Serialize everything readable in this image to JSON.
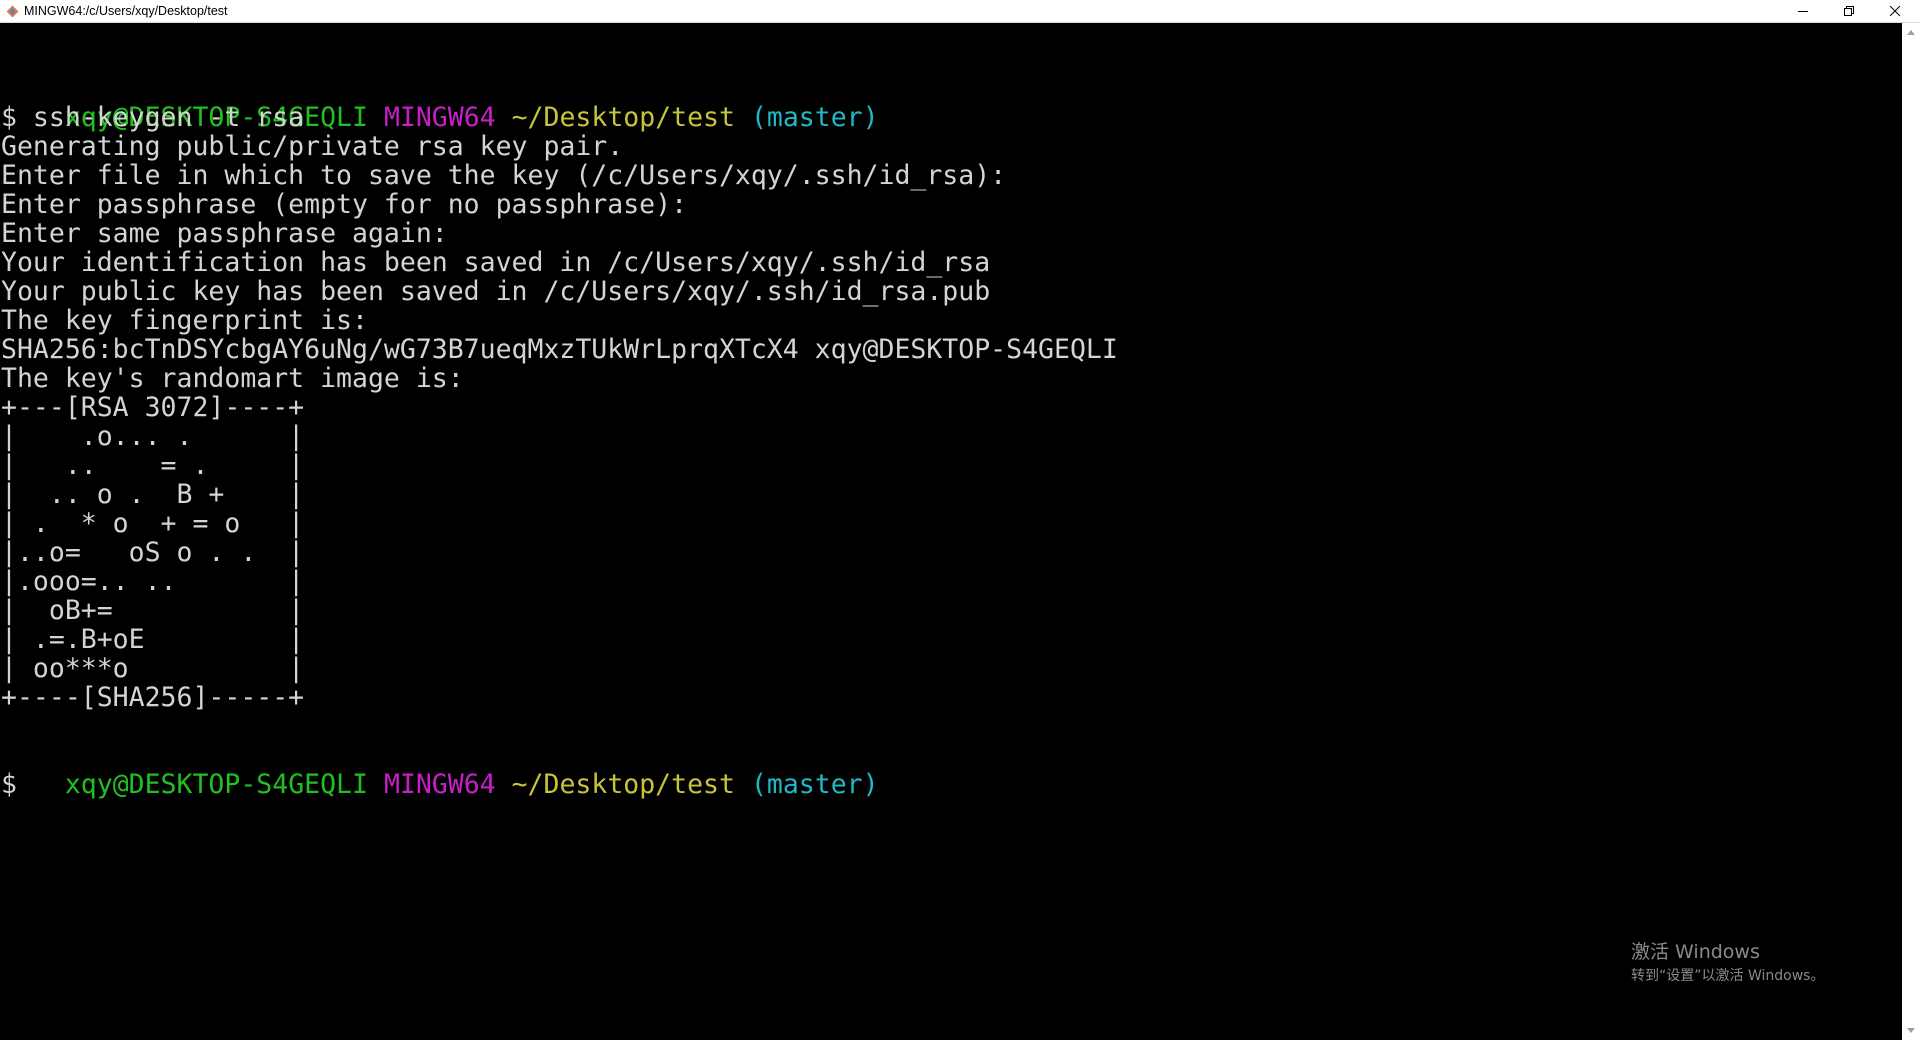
{
  "window": {
    "title": "MINGW64:/c/Users/xqy/Desktop/test",
    "icon": "git-bash-icon"
  },
  "terminal": {
    "prompt1": {
      "user": "xqy@DESKTOP-S4GEQLI",
      "system": "MINGW64",
      "path": "~/Desktop/test",
      "branch": "(master)"
    },
    "command": "$ ssh-keygen -t rsa",
    "output": [
      "Generating public/private rsa key pair.",
      "Enter file in which to save the key (/c/Users/xqy/.ssh/id_rsa):",
      "Enter passphrase (empty for no passphrase):",
      "Enter same passphrase again:",
      "Your identification has been saved in /c/Users/xqy/.ssh/id_rsa",
      "Your public key has been saved in /c/Users/xqy/.ssh/id_rsa.pub",
      "The key fingerprint is:",
      "SHA256:bcTnDSYcbgAY6uNg/wG73B7ueqMxzTUkWrLprqXTcX4 xqy@DESKTOP-S4GEQLI",
      "The key's randomart image is:",
      "+---[RSA 3072]----+",
      "|    .o... .      |",
      "|   ..    = .     |",
      "|  .. o .  B +    |",
      "| .  * o  + = o   |",
      "|..o=   oS o . .  |",
      "|.ooo=.. ..       |",
      "|  oB+=           |",
      "| .=.B+oE         |",
      "| oo***o          |",
      "+----[SHA256]-----+"
    ],
    "prompt2": {
      "user": "xqy@DESKTOP-S4GEQLI",
      "system": "MINGW64",
      "path": "~/Desktop/test",
      "branch": "(master)"
    },
    "cursor_line": "$",
    "colors": {
      "background": "#000000",
      "text": "#d4d4d4",
      "user": "#20c020",
      "system": "#c520c5",
      "path": "#c8c43a",
      "branch": "#1fb8c6"
    }
  },
  "watermark": {
    "title": "激活 Windows",
    "subtitle": "转到“设置”以激活 Windows。"
  }
}
